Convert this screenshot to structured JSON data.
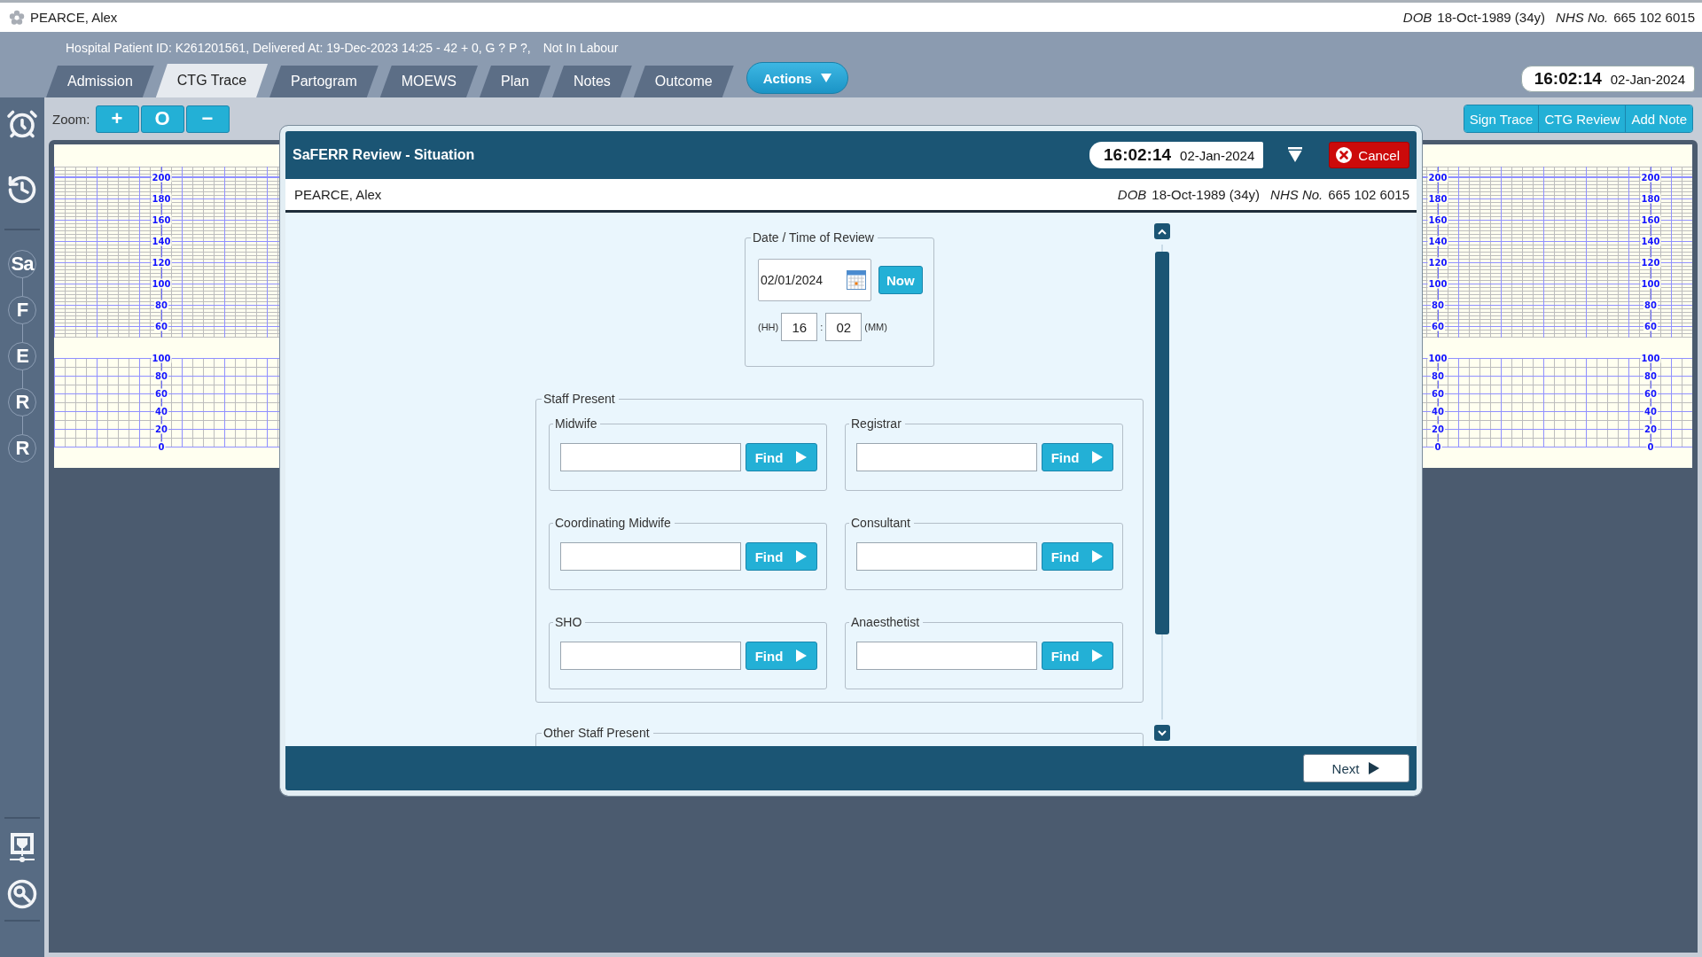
{
  "patient_bar": {
    "name": "PEARCE, Alex",
    "dob_label": "DOB",
    "dob": "18-Oct-1989 (34y)",
    "nhs_label": "NHS No.",
    "nhs_number": "665 102 6015"
  },
  "banner": {
    "info": "Hospital Patient ID: K261201561, Delivered At: 19-Dec-2023 14:25 - 42 + 0, G ? P ?,",
    "labour_status": "Not In Labour"
  },
  "tabs": [
    {
      "label": "Admission",
      "selected": false
    },
    {
      "label": "CTG Trace",
      "selected": true
    },
    {
      "label": "Partogram",
      "selected": false
    },
    {
      "label": "MOEWS",
      "selected": false
    },
    {
      "label": "Plan",
      "selected": false
    },
    {
      "label": "Notes",
      "selected": false
    },
    {
      "label": "Outcome",
      "selected": false
    }
  ],
  "actions_button": "Actions",
  "clock": {
    "time": "16:02:14",
    "date": "02-Jan-2024"
  },
  "sidebar": {
    "steps": [
      "Sa",
      "F",
      "E",
      "R",
      "R"
    ]
  },
  "zoom": {
    "label": "Zoom:",
    "buttons": [
      "+",
      "O",
      "−"
    ]
  },
  "trace_buttons": [
    "Sign Trace",
    "CTG Review",
    "Add Note"
  ],
  "trace_scales": [
    {
      "fhr": [
        "200",
        "180",
        "160",
        "140",
        "120",
        "100",
        "80",
        "60"
      ],
      "toco": [
        "100",
        "80",
        "60",
        "40",
        "20",
        "0"
      ]
    },
    {
      "fhr": [
        "200",
        "180",
        "160",
        "140",
        "120",
        "100",
        "80",
        "60"
      ],
      "toco": [
        "100",
        "80",
        "60",
        "40",
        "20",
        "0"
      ]
    },
    {
      "fhr": [
        "200",
        "180",
        "160",
        "140",
        "120",
        "100",
        "80",
        "60"
      ],
      "toco": [
        "100",
        "80",
        "60",
        "40",
        "20",
        "0"
      ]
    }
  ],
  "dialog": {
    "title": "SaFERR Review - Situation",
    "clock": {
      "time": "16:02:14",
      "date": "02-Jan-2024"
    },
    "cancel": "Cancel",
    "patient": {
      "name": "PEARCE, Alex",
      "dob_label": "DOB",
      "dob": "18-Oct-1989 (34y)",
      "nhs_label": "NHS No.",
      "nhs_number": "665 102 6015"
    },
    "review_time": {
      "legend": "Date / Time of Review",
      "date": "02/01/2024",
      "now_button": "Now",
      "hour_label": "(HH)",
      "hour": "16",
      "separator": ":",
      "minute": "02",
      "minute_label": "(MM)"
    },
    "staff_present": {
      "legend": "Staff Present",
      "roles": [
        {
          "label": "Midwife",
          "button": "Find"
        },
        {
          "label": "Registrar",
          "button": "Find"
        },
        {
          "label": "Coordinating Midwife",
          "button": "Find"
        },
        {
          "label": "Consultant",
          "button": "Find"
        },
        {
          "label": "SHO",
          "button": "Find"
        },
        {
          "label": "Anaesthetist",
          "button": "Find"
        }
      ]
    },
    "other_staff": {
      "legend": "Other Staff Present"
    },
    "next_button": "Next"
  }
}
